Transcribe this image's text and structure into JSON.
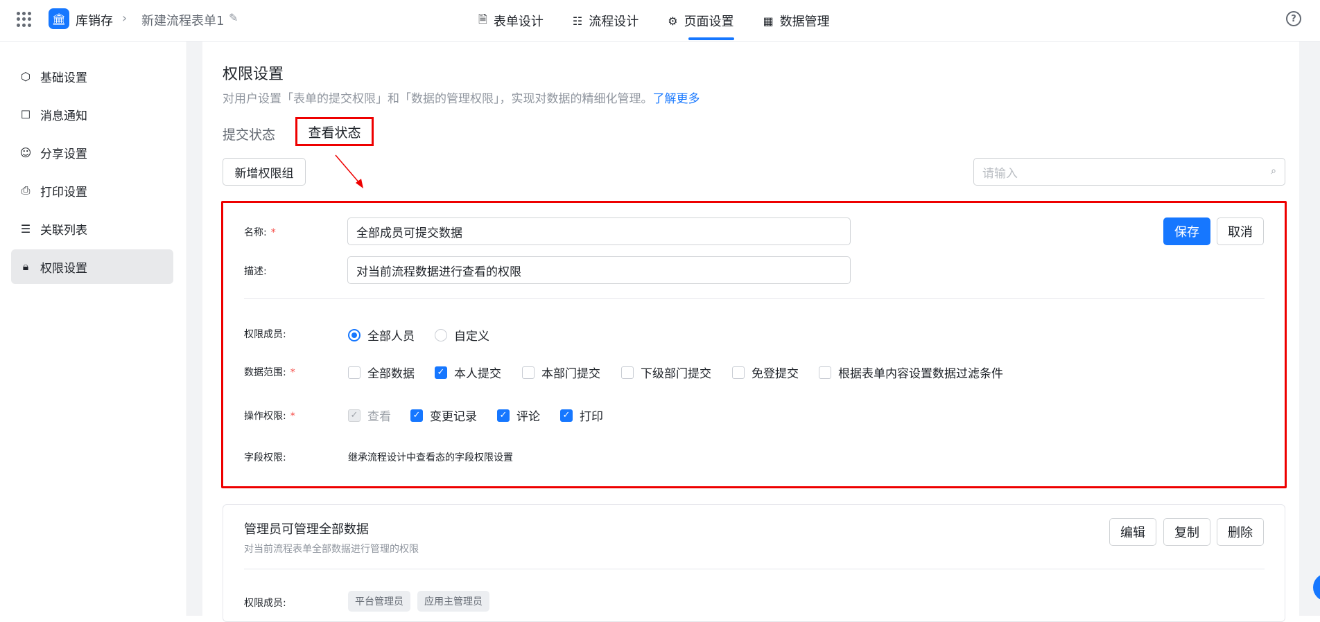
{
  "header": {
    "app_name": "库销存",
    "form_name": "新建流程表单1",
    "tabs": [
      {
        "label": "表单设计",
        "icon": "form-icon"
      },
      {
        "label": "流程设计",
        "icon": "flow-icon"
      },
      {
        "label": "页面设置",
        "icon": "gear-icon"
      },
      {
        "label": "数据管理",
        "icon": "table-icon"
      }
    ],
    "accent": "#1677ff"
  },
  "sidebar": {
    "items": [
      {
        "label": "基础设置",
        "icon": "cube-icon"
      },
      {
        "label": "消息通知",
        "icon": "message-icon"
      },
      {
        "label": "分享设置",
        "icon": "share-user-icon"
      },
      {
        "label": "打印设置",
        "icon": "printer-icon"
      },
      {
        "label": "关联列表",
        "icon": "list-icon"
      },
      {
        "label": "权限设置",
        "icon": "lock-icon"
      }
    ],
    "active": "权限设置"
  },
  "section": {
    "title": "权限设置",
    "desc": "对用户设置「表单的提交权限」和「数据的管理权限」，实现对数据的精细化管理。",
    "link": "了解更多",
    "tabs": [
      "提交状态",
      "查看状态"
    ],
    "add_button": "新增权限组",
    "search_placeholder": "请输入"
  },
  "edit_card": {
    "name_label": "名称:",
    "name_value": "全部成员可提交数据",
    "desc_label": "描述:",
    "desc_value": "对当前流程数据进行查看的权限",
    "save": "保存",
    "cancel": "取消",
    "members_label": "权限成员:",
    "members_options": [
      "全部人员",
      "自定义"
    ],
    "members_selected": "全部人员",
    "scope_label": "数据范围:",
    "scope_options": [
      {
        "label": "全部数据",
        "checked": false
      },
      {
        "label": "本人提交",
        "checked": true
      },
      {
        "label": "本部门提交",
        "checked": false
      },
      {
        "label": "下级部门提交",
        "checked": false
      },
      {
        "label": "免登提交",
        "checked": false
      },
      {
        "label": "根据表单内容设置数据过滤条件",
        "checked": false
      }
    ],
    "ops_label": "操作权限:",
    "ops_options": [
      {
        "label": "查看",
        "checked": true,
        "disabled": true
      },
      {
        "label": "变更记录",
        "checked": true,
        "disabled": false
      },
      {
        "label": "评论",
        "checked": true,
        "disabled": false
      },
      {
        "label": "打印",
        "checked": true,
        "disabled": false
      }
    ],
    "field_label": "字段权限:",
    "field_value": "继承流程设计中查看态的字段权限设置",
    "required_mark": "*"
  },
  "card2": {
    "title": "管理员可管理全部数据",
    "desc": "对当前流程表单全部数据进行管理的权限",
    "buttons": [
      "编辑",
      "复制",
      "删除"
    ],
    "members_label": "权限成员:",
    "tags": [
      "平台管理员",
      "应用主管理员"
    ]
  },
  "annotation_color": "#e00000"
}
